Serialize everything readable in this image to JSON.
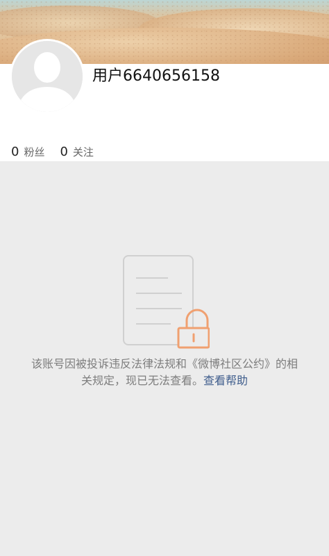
{
  "profile": {
    "username": "用户6640656158",
    "stats": [
      {
        "count": "0",
        "label": "粉丝"
      },
      {
        "count": "0",
        "label": "关注"
      }
    ]
  },
  "notice": {
    "message": "该账号因被投诉违反法律法规和《微博社区公约》的相关规定，现已无法查看。",
    "help_link": "查看帮助"
  },
  "icons": {
    "avatar": "default-avatar-icon",
    "notice": "locked-document-icon"
  },
  "colors": {
    "link": "#3f5d8c",
    "lock": "#f0a070",
    "background": "#ececec"
  }
}
